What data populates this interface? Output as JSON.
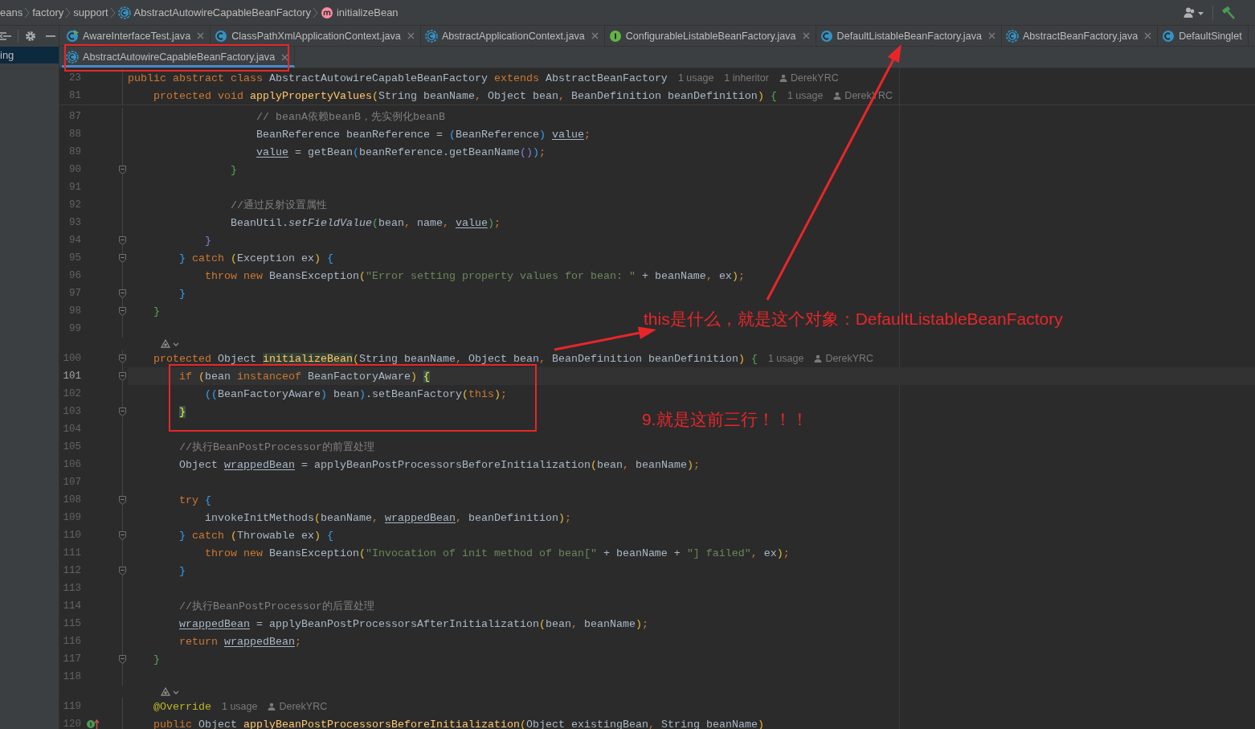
{
  "breadcrumbs": [
    {
      "label": "eans",
      "kind": "package"
    },
    {
      "label": "factory",
      "kind": "package"
    },
    {
      "label": "support",
      "kind": "package"
    },
    {
      "label": "AbstractAutowireCapableBeanFactory",
      "kind": "abstract_class"
    },
    {
      "label": "initializeBean",
      "kind": "method"
    }
  ],
  "sidebar": {
    "items": [
      {
        "label": "ing",
        "selected": true
      }
    ]
  },
  "tabs": [
    {
      "label": "AwareInterfaceTest.java",
      "kind": "test_class",
      "selected": false,
      "closable": true
    },
    {
      "label": "ClassPathXmlApplicationContext.java",
      "kind": "class",
      "selected": false,
      "closable": true
    },
    {
      "label": "AbstractApplicationContext.java",
      "kind": "abstract_class",
      "selected": false,
      "closable": true
    },
    {
      "label": "ConfigurableListableBeanFactory.java",
      "kind": "interface",
      "selected": false,
      "closable": true
    },
    {
      "label": "DefaultListableBeanFactory.java",
      "kind": "class",
      "selected": false,
      "closable": true
    },
    {
      "label": "AbstractBeanFactory.java",
      "kind": "abstract_class",
      "selected": false,
      "closable": true
    },
    {
      "label": "DefaultSinglet",
      "kind": "class",
      "selected": false,
      "closable": false
    }
  ],
  "tabs_row_2": [
    {
      "label": "AbstractAutowireCapableBeanFactory.java",
      "kind": "abstract_class",
      "selected": true,
      "closable": true
    }
  ],
  "sticky_lines": [
    {
      "n": "23",
      "tokens": [
        {
          "kind": "kw",
          "text": "public abstract class "
        },
        {
          "kind": "id",
          "text": "AbstractAutowireCapableBeanFactory "
        },
        {
          "kind": "kw",
          "text": "extends "
        },
        {
          "kind": "id",
          "text": "AbstractBeanFactory"
        },
        {
          "kind": "hint",
          "text": "1 usage"
        },
        {
          "kind": "hint",
          "text": "1 inheritor"
        },
        {
          "kind": "author",
          "text": "DerekYRC"
        }
      ]
    },
    {
      "n": "81",
      "tokens": [
        {
          "kind": "kw",
          "text": "    protected void "
        },
        {
          "kind": "fn",
          "text": "applyPropertyValues"
        },
        {
          "kind": "b1",
          "text": "("
        },
        {
          "kind": "id",
          "text": "String beanName"
        },
        {
          "kind": "punct",
          "text": ", "
        },
        {
          "kind": "id",
          "text": "Object bean"
        },
        {
          "kind": "punct",
          "text": ", "
        },
        {
          "kind": "id",
          "text": "BeanDefinition beanDefinition"
        },
        {
          "kind": "b1",
          "text": ") "
        },
        {
          "kind": "b2",
          "text": "{"
        },
        {
          "kind": "hint",
          "text": "1 usage"
        },
        {
          "kind": "author",
          "text": "DerekYRC"
        }
      ]
    }
  ],
  "lines": [
    {
      "kind": "code",
      "n": "87",
      "fold": false,
      "current": false,
      "tokens": [
        {
          "kind": "cmt",
          "text": "                    // beanA依赖beanB，先实例化beanB"
        }
      ]
    },
    {
      "kind": "code",
      "n": "88",
      "fold": false,
      "current": false,
      "tokens": [
        {
          "kind": "id",
          "text": "                    BeanReference beanReference = "
        },
        {
          "kind": "b3",
          "text": "("
        },
        {
          "kind": "id",
          "text": "BeanReference"
        },
        {
          "kind": "b3",
          "text": ") "
        },
        {
          "kind": "var",
          "text": "value"
        },
        {
          "kind": "punct",
          "text": ";"
        }
      ]
    },
    {
      "kind": "code",
      "n": "89",
      "fold": false,
      "current": false,
      "tokens": [
        {
          "kind": "var",
          "text": "                    value"
        },
        {
          "kind": "id",
          "text": " = getBean"
        },
        {
          "kind": "b3",
          "text": "("
        },
        {
          "kind": "id",
          "text": "beanReference.getBeanName"
        },
        {
          "kind": "b4",
          "text": "()"
        },
        {
          "kind": "b3",
          "text": ")"
        },
        {
          "kind": "punct",
          "text": ";"
        }
      ]
    },
    {
      "kind": "code",
      "n": "90",
      "fold": true,
      "current": false,
      "tokens": [
        {
          "kind": "b2",
          "text": "                }"
        }
      ]
    },
    {
      "kind": "code",
      "n": "91",
      "fold": false,
      "current": false
    },
    {
      "kind": "code",
      "n": "92",
      "fold": false,
      "current": false,
      "tokens": [
        {
          "kind": "cmt",
          "text": "                //通过反射设置属性"
        }
      ]
    },
    {
      "kind": "code",
      "n": "93",
      "fold": false,
      "current": false,
      "tokens": [
        {
          "kind": "id",
          "text": "                BeanUtil."
        },
        {
          "kind": "static",
          "text": "setFieldValue"
        },
        {
          "kind": "b2",
          "text": "("
        },
        {
          "kind": "id",
          "text": "bean"
        },
        {
          "kind": "punct",
          "text": ", "
        },
        {
          "kind": "id",
          "text": "name"
        },
        {
          "kind": "punct",
          "text": ", "
        },
        {
          "kind": "var",
          "text": "value"
        },
        {
          "kind": "b2",
          "text": ")"
        },
        {
          "kind": "punct",
          "text": ";"
        }
      ]
    },
    {
      "kind": "code",
      "n": "94",
      "fold": true,
      "current": false,
      "tokens": [
        {
          "kind": "b4",
          "text": "            }"
        }
      ]
    },
    {
      "kind": "code",
      "n": "95",
      "fold": true,
      "current": false,
      "tokens": [
        {
          "kind": "b3",
          "text": "        }"
        },
        {
          "kind": "kw",
          "text": " catch "
        },
        {
          "kind": "b1",
          "text": "("
        },
        {
          "kind": "id",
          "text": "Exception ex"
        },
        {
          "kind": "b1",
          "text": ") "
        },
        {
          "kind": "b3",
          "text": "{"
        }
      ]
    },
    {
      "kind": "code",
      "n": "96",
      "fold": false,
      "current": false,
      "tokens": [
        {
          "kind": "kw",
          "text": "            throw new "
        },
        {
          "kind": "id",
          "text": "BeansException"
        },
        {
          "kind": "b1",
          "text": "("
        },
        {
          "kind": "str",
          "text": "\"Error setting property values for bean: \""
        },
        {
          "kind": "id",
          "text": " + beanName"
        },
        {
          "kind": "punct",
          "text": ", "
        },
        {
          "kind": "id",
          "text": "ex"
        },
        {
          "kind": "b1",
          "text": ")"
        },
        {
          "kind": "punct",
          "text": ";"
        }
      ]
    },
    {
      "kind": "code",
      "n": "97",
      "fold": true,
      "current": false,
      "tokens": [
        {
          "kind": "b3",
          "text": "        }"
        }
      ]
    },
    {
      "kind": "code",
      "n": "98",
      "fold": true,
      "current": false,
      "tokens": [
        {
          "kind": "b2",
          "text": "    }"
        }
      ]
    },
    {
      "kind": "code",
      "n": "99",
      "fold": false,
      "current": false
    },
    {
      "kind": "inlay"
    },
    {
      "kind": "code",
      "n": "100",
      "fold": true,
      "current": false,
      "tokens": [
        {
          "kind": "kw",
          "text": "    protected "
        },
        {
          "kind": "id",
          "text": "Object "
        },
        {
          "kind": "fnhl",
          "text": "initializeBean"
        },
        {
          "kind": "b1",
          "text": "("
        },
        {
          "kind": "id",
          "text": "String beanName"
        },
        {
          "kind": "punct",
          "text": ", "
        },
        {
          "kind": "id",
          "text": "Object bean"
        },
        {
          "kind": "punct",
          "text": ", "
        },
        {
          "kind": "id",
          "text": "BeanDefinition beanDefinition"
        },
        {
          "kind": "b1",
          "text": ") "
        },
        {
          "kind": "b2",
          "text": "{"
        },
        {
          "kind": "hint",
          "text": "1 usage"
        },
        {
          "kind": "author",
          "text": "DerekYRC"
        }
      ]
    },
    {
      "kind": "code",
      "n": "101",
      "fold": true,
      "current": true,
      "tokens": [
        {
          "kind": "kw",
          "text": "        if "
        },
        {
          "kind": "b1",
          "text": "("
        },
        {
          "kind": "id",
          "text": "bean "
        },
        {
          "kind": "kw",
          "text": "instanceof "
        },
        {
          "kind": "id",
          "text": "BeanFactoryAware"
        },
        {
          "kind": "b1",
          "text": ") "
        },
        {
          "kind": "bracehl",
          "text": "{"
        }
      ]
    },
    {
      "kind": "code",
      "n": "102",
      "fold": false,
      "current": false,
      "tokens": [
        {
          "kind": "b3",
          "text": "            (("
        },
        {
          "kind": "id",
          "text": "BeanFactoryAware"
        },
        {
          "kind": "b3",
          "text": ")"
        },
        {
          "kind": "id",
          "text": " bean"
        },
        {
          "kind": "b3",
          "text": ")"
        },
        {
          "kind": "id",
          "text": ".setBeanFactory"
        },
        {
          "kind": "b1",
          "text": "("
        },
        {
          "kind": "kw",
          "text": "this"
        },
        {
          "kind": "b1",
          "text": ")"
        },
        {
          "kind": "punct",
          "text": ";"
        }
      ]
    },
    {
      "kind": "code",
      "n": "103",
      "fold": true,
      "current": false,
      "tokens": [
        {
          "kind": "bracehl",
          "text": "        }"
        }
      ]
    },
    {
      "kind": "code",
      "n": "104",
      "fold": false,
      "current": false
    },
    {
      "kind": "code",
      "n": "105",
      "fold": false,
      "current": false,
      "tokens": [
        {
          "kind": "cmt",
          "text": "        //执行BeanPostProcessor的前置处理"
        }
      ]
    },
    {
      "kind": "code",
      "n": "106",
      "fold": false,
      "current": false,
      "tokens": [
        {
          "kind": "id",
          "text": "        Object "
        },
        {
          "kind": "var",
          "text": "wrappedBean"
        },
        {
          "kind": "id",
          "text": " = applyBeanPostProcessorsBeforeInitialization"
        },
        {
          "kind": "b1",
          "text": "("
        },
        {
          "kind": "id",
          "text": "bean"
        },
        {
          "kind": "punct",
          "text": ", "
        },
        {
          "kind": "id",
          "text": "beanName"
        },
        {
          "kind": "b1",
          "text": ")"
        },
        {
          "kind": "punct",
          "text": ";"
        }
      ]
    },
    {
      "kind": "code",
      "n": "107",
      "fold": false,
      "current": false
    },
    {
      "kind": "code",
      "n": "108",
      "fold": true,
      "current": false,
      "tokens": [
        {
          "kind": "kw",
          "text": "        try "
        },
        {
          "kind": "b3",
          "text": "{"
        }
      ]
    },
    {
      "kind": "code",
      "n": "109",
      "fold": false,
      "current": false,
      "tokens": [
        {
          "kind": "id",
          "text": "            invokeInitMethods"
        },
        {
          "kind": "b1",
          "text": "("
        },
        {
          "kind": "id",
          "text": "beanName"
        },
        {
          "kind": "punct",
          "text": ", "
        },
        {
          "kind": "var",
          "text": "wrappedBean"
        },
        {
          "kind": "punct",
          "text": ", "
        },
        {
          "kind": "id",
          "text": "beanDefinition"
        },
        {
          "kind": "b1",
          "text": ")"
        },
        {
          "kind": "punct",
          "text": ";"
        }
      ]
    },
    {
      "kind": "code",
      "n": "110",
      "fold": true,
      "current": false,
      "tokens": [
        {
          "kind": "b3",
          "text": "        }"
        },
        {
          "kind": "kw",
          "text": " catch "
        },
        {
          "kind": "b1",
          "text": "("
        },
        {
          "kind": "id",
          "text": "Throwable ex"
        },
        {
          "kind": "b1",
          "text": ") "
        },
        {
          "kind": "b3",
          "text": "{"
        }
      ]
    },
    {
      "kind": "code",
      "n": "111",
      "fold": false,
      "current": false,
      "tokens": [
        {
          "kind": "kw",
          "text": "            throw new "
        },
        {
          "kind": "id",
          "text": "BeansException"
        },
        {
          "kind": "b1",
          "text": "("
        },
        {
          "kind": "str",
          "text": "\"Invocation of init method of bean[\""
        },
        {
          "kind": "id",
          "text": " + beanName + "
        },
        {
          "kind": "str",
          "text": "\"] failed\""
        },
        {
          "kind": "punct",
          "text": ", "
        },
        {
          "kind": "id",
          "text": "ex"
        },
        {
          "kind": "b1",
          "text": ")"
        },
        {
          "kind": "punct",
          "text": ";"
        }
      ]
    },
    {
      "kind": "code",
      "n": "112",
      "fold": true,
      "current": false,
      "tokens": [
        {
          "kind": "b3",
          "text": "        }"
        }
      ]
    },
    {
      "kind": "code",
      "n": "113",
      "fold": false,
      "current": false
    },
    {
      "kind": "code",
      "n": "114",
      "fold": false,
      "current": false,
      "tokens": [
        {
          "kind": "cmt",
          "text": "        //执行BeanPostProcessor的后置处理"
        }
      ]
    },
    {
      "kind": "code",
      "n": "115",
      "fold": false,
      "current": false,
      "tokens": [
        {
          "kind": "var",
          "text": "        wrappedBean"
        },
        {
          "kind": "id",
          "text": " = applyBeanPostProcessorsAfterInitialization"
        },
        {
          "kind": "b1",
          "text": "("
        },
        {
          "kind": "id",
          "text": "bean"
        },
        {
          "kind": "punct",
          "text": ", "
        },
        {
          "kind": "id",
          "text": "beanName"
        },
        {
          "kind": "b1",
          "text": ")"
        },
        {
          "kind": "punct",
          "text": ";"
        }
      ]
    },
    {
      "kind": "code",
      "n": "116",
      "fold": false,
      "current": false,
      "tokens": [
        {
          "kind": "kw",
          "text": "        return "
        },
        {
          "kind": "var",
          "text": "wrappedBean"
        },
        {
          "kind": "punct",
          "text": ";"
        }
      ]
    },
    {
      "kind": "code",
      "n": "117",
      "fold": true,
      "current": false,
      "tokens": [
        {
          "kind": "b2",
          "text": "    }"
        }
      ]
    },
    {
      "kind": "code",
      "n": "118",
      "fold": false,
      "current": false
    },
    {
      "kind": "inlay"
    },
    {
      "kind": "code",
      "n": "119",
      "fold": false,
      "current": false,
      "tokens": [
        {
          "kind": "ann",
          "text": "    @Override"
        },
        {
          "kind": "hint",
          "text": "1 usage"
        },
        {
          "kind": "author",
          "text": "DerekYRC"
        }
      ]
    },
    {
      "kind": "code",
      "n": "120",
      "fold": false,
      "current": false,
      "implemented": true,
      "tokens": [
        {
          "kind": "kw",
          "text": "    public "
        },
        {
          "kind": "id",
          "text": "Object "
        },
        {
          "kind": "fn",
          "text": "applyBeanPostProcessorsBeforeInitialization"
        },
        {
          "kind": "b1",
          "text": "("
        },
        {
          "kind": "id",
          "text": "Object existingBean"
        },
        {
          "kind": "punct",
          "text": ", "
        },
        {
          "kind": "id",
          "text": "String beanName"
        },
        {
          "kind": "b1",
          "text": ")"
        }
      ]
    }
  ],
  "annotations": [
    {
      "kind": "box"
    },
    {
      "kind": "box"
    },
    {
      "kind": "arrow"
    },
    {
      "kind": "arrow"
    },
    {
      "kind": "note",
      "text": "this是什么，就是这个对象：DefaultListableBeanFactory"
    },
    {
      "kind": "note",
      "text": "9.就是这前三行！！！"
    }
  ]
}
